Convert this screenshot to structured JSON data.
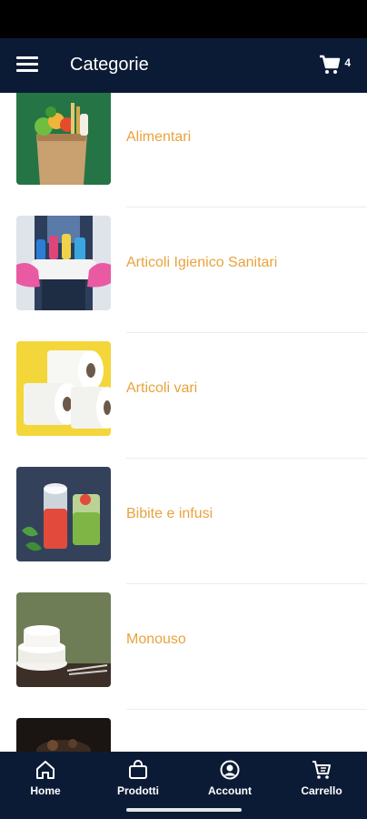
{
  "header": {
    "title": "Categorie",
    "menu_icon": "hamburger-menu-icon",
    "cart_icon": "shopping-cart-icon",
    "cart_count": "4"
  },
  "categories": [
    {
      "label": "Alimentari",
      "image": "grocery-bag-image"
    },
    {
      "label": "Articoli Igienico Sanitari",
      "image": "cleaning-supplies-image"
    },
    {
      "label": "Articoli vari",
      "image": "paper-rolls-image"
    },
    {
      "label": "Bibite e infusi",
      "image": "drinks-image"
    },
    {
      "label": "Monouso",
      "image": "disposable-plates-image"
    },
    {
      "label": "",
      "image": "dark-food-image"
    }
  ],
  "bottom_nav": [
    {
      "label": "Home",
      "icon": "home-icon"
    },
    {
      "label": "Prodotti",
      "icon": "shopping-bag-icon"
    },
    {
      "label": "Account",
      "icon": "account-icon"
    },
    {
      "label": "Carrello",
      "icon": "cart-icon"
    }
  ],
  "colors": {
    "header_bg": "#0c1b35",
    "accent_label": "#e8a33d",
    "nav_bg": "#0c1b35"
  }
}
